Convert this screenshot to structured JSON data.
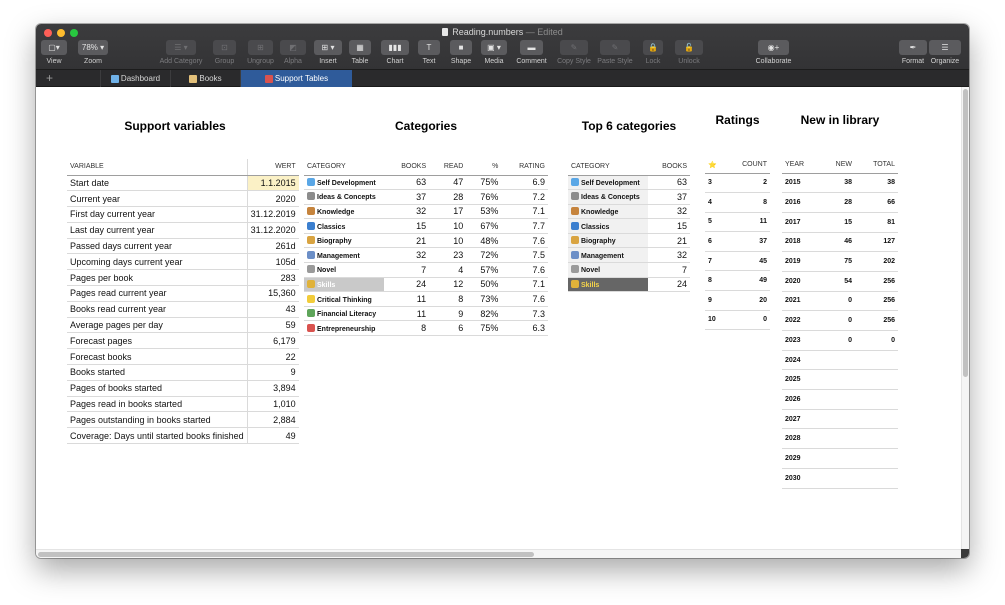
{
  "window": {
    "file_name": "Reading.numbers",
    "edited_suffix": "— Edited"
  },
  "toolbar": {
    "items": [
      {
        "name": "view-button",
        "label": "View",
        "btn": "▢▾",
        "dim": false
      },
      {
        "name": "zoom-button",
        "label": "Zoom",
        "btn": "78% ▾",
        "dim": false
      },
      {
        "name": "add-category-button",
        "label": "Add Category",
        "btn": "☰ ▾",
        "dim": true
      },
      {
        "name": "group-button",
        "label": "Group",
        "btn": "⊡",
        "dim": true
      },
      {
        "name": "ungroup-button",
        "label": "Ungroup",
        "btn": "⊞",
        "dim": true
      },
      {
        "name": "alpha-button",
        "label": "Alpha",
        "btn": "◩",
        "dim": true
      },
      {
        "name": "insert-button",
        "label": "Insert",
        "btn": "⊞ ▾",
        "dim": false
      },
      {
        "name": "table-button",
        "label": "Table",
        "btn": "▦",
        "dim": false
      },
      {
        "name": "chart-button",
        "label": "Chart",
        "btn": "▮▮▮",
        "dim": false
      },
      {
        "name": "text-button",
        "label": "Text",
        "btn": "T",
        "dim": false
      },
      {
        "name": "shape-button",
        "label": "Shape",
        "btn": "■",
        "dim": false
      },
      {
        "name": "media-button",
        "label": "Media",
        "btn": "▣ ▾",
        "dim": false
      },
      {
        "name": "comment-button",
        "label": "Comment",
        "btn": "▬",
        "dim": false
      },
      {
        "name": "copy-style-button",
        "label": "Copy Style",
        "btn": "✎",
        "dim": true
      },
      {
        "name": "paste-style-button",
        "label": "Paste Style",
        "btn": "✎",
        "dim": true
      },
      {
        "name": "lock-button",
        "label": "Lock",
        "btn": "🔒",
        "dim": true
      },
      {
        "name": "unlock-button",
        "label": "Unlock",
        "btn": "🔓",
        "dim": true
      },
      {
        "name": "collaborate-button",
        "label": "Collaborate",
        "btn": "◉+",
        "dim": false
      },
      {
        "name": "format-button",
        "label": "Format",
        "btn": "✒",
        "dim": false
      },
      {
        "name": "organize-button",
        "label": "Organize",
        "btn": "☰",
        "dim": false
      }
    ]
  },
  "tabs": [
    {
      "label": "Dashboard",
      "icon": "chart-icon",
      "active": false
    },
    {
      "label": "Books",
      "icon": "book-icon",
      "active": false
    },
    {
      "label": "Support Tables",
      "icon": "target-icon",
      "active": true
    }
  ],
  "support_variables": {
    "title": "Support variables",
    "headers": [
      "VARIABLE",
      "WERT"
    ],
    "rows": [
      [
        "Start date",
        "1.1.2015"
      ],
      [
        "Current year",
        "2020"
      ],
      [
        "First day current year",
        "31.12.2019"
      ],
      [
        "Last day current year",
        "31.12.2020"
      ],
      [
        "Passed days current year",
        "261d"
      ],
      [
        "Upcoming days current year",
        "105d"
      ],
      [
        "Pages per book",
        "283"
      ],
      [
        "Pages read current year",
        "15,360"
      ],
      [
        "Books read current year",
        "43"
      ],
      [
        "Average pages per day",
        "59"
      ],
      [
        "Forecast pages",
        "6,179"
      ],
      [
        "Forecast books",
        "22"
      ],
      [
        "Books started",
        "9"
      ],
      [
        "Pages of books started",
        "3,894"
      ],
      [
        "Pages read in books started",
        "1,010"
      ],
      [
        "Pages outstanding in books started",
        "2,884"
      ],
      [
        "Coverage: Days until started books finished",
        "49"
      ]
    ]
  },
  "categories": {
    "title": "Categories",
    "headers": [
      "CATEGORY",
      "BOOKS",
      "READ",
      "%",
      "RATING"
    ],
    "rows": [
      {
        "cat": "Self Development",
        "icon": "#5aa7e6",
        "books": "63",
        "read": "47",
        "pct": "75%",
        "rating": "6.9"
      },
      {
        "cat": "Ideas & Concepts",
        "icon": "#8c8c8c",
        "books": "37",
        "read": "28",
        "pct": "76%",
        "rating": "7.2"
      },
      {
        "cat": "Knowledge",
        "icon": "#c6843d",
        "books": "32",
        "read": "17",
        "pct": "53%",
        "rating": "7.1"
      },
      {
        "cat": "Classics",
        "icon": "#3b7fcf",
        "books": "15",
        "read": "10",
        "pct": "67%",
        "rating": "7.7"
      },
      {
        "cat": "Biography",
        "icon": "#d9a441",
        "books": "21",
        "read": "10",
        "pct": "48%",
        "rating": "7.6"
      },
      {
        "cat": "Management",
        "icon": "#6c8fc7",
        "books": "32",
        "read": "23",
        "pct": "72%",
        "rating": "7.5"
      },
      {
        "cat": "Novel",
        "icon": "#9a9a9a",
        "books": "7",
        "read": "4",
        "pct": "57%",
        "rating": "7.6"
      },
      {
        "cat": "Skills",
        "icon": "#e0b23a",
        "books": "24",
        "read": "12",
        "pct": "50%",
        "rating": "7.1"
      },
      {
        "cat": "Critical Thinking",
        "icon": "#f2cc3a",
        "books": "11",
        "read": "8",
        "pct": "73%",
        "rating": "7.6"
      },
      {
        "cat": "Financial Literacy",
        "icon": "#5ea55a",
        "books": "11",
        "read": "9",
        "pct": "82%",
        "rating": "7.3"
      },
      {
        "cat": "Entrepreneurship",
        "icon": "#d9534f",
        "books": "8",
        "read": "6",
        "pct": "75%",
        "rating": "6.3"
      }
    ]
  },
  "top6": {
    "title": "Top 6 categories",
    "headers": [
      "CATEGORY",
      "BOOKS"
    ],
    "rows": [
      {
        "cat": "Self Development",
        "icon": "#5aa7e6",
        "books": "63"
      },
      {
        "cat": "Ideas & Concepts",
        "icon": "#8c8c8c",
        "books": "37"
      },
      {
        "cat": "Knowledge",
        "icon": "#c6843d",
        "books": "32"
      },
      {
        "cat": "Classics",
        "icon": "#3b7fcf",
        "books": "15"
      },
      {
        "cat": "Biography",
        "icon": "#d9a441",
        "books": "21"
      },
      {
        "cat": "Management",
        "icon": "#6c8fc7",
        "books": "32"
      },
      {
        "cat": "Novel",
        "icon": "#9a9a9a",
        "books": "7"
      },
      {
        "cat": "Skills",
        "icon": "#e0b23a",
        "books": "24"
      }
    ]
  },
  "ratings": {
    "title": "Ratings",
    "headers": [
      "⭐",
      "COUNT"
    ],
    "rows": [
      [
        "3",
        "2"
      ],
      [
        "4",
        "8"
      ],
      [
        "5",
        "11"
      ],
      [
        "6",
        "37"
      ],
      [
        "7",
        "45"
      ],
      [
        "8",
        "49"
      ],
      [
        "9",
        "20"
      ],
      [
        "10",
        "0"
      ]
    ]
  },
  "library": {
    "title": "New in library",
    "headers": [
      "YEAR",
      "NEW",
      "TOTAL"
    ],
    "rows": [
      [
        "2015",
        "38",
        "38"
      ],
      [
        "2016",
        "28",
        "66"
      ],
      [
        "2017",
        "15",
        "81"
      ],
      [
        "2018",
        "46",
        "127"
      ],
      [
        "2019",
        "75",
        "202"
      ],
      [
        "2020",
        "54",
        "256"
      ],
      [
        "2021",
        "0",
        "256"
      ],
      [
        "2022",
        "0",
        "256"
      ],
      [
        "2023",
        "0",
        "0"
      ],
      [
        "2024",
        "",
        ""
      ],
      [
        "2025",
        "",
        ""
      ],
      [
        "2026",
        "",
        ""
      ],
      [
        "2027",
        "",
        ""
      ],
      [
        "2028",
        "",
        ""
      ],
      [
        "2029",
        "",
        ""
      ],
      [
        "2030",
        "",
        ""
      ]
    ]
  },
  "colors": {
    "accent_tab": "#2f5b9a",
    "highlight_cell": "#fbf1c6"
  }
}
